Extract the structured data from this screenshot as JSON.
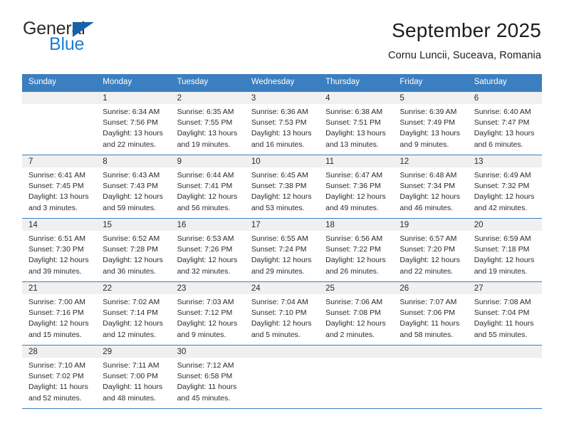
{
  "logo": {
    "primary_text": "General",
    "secondary_text": "Blue",
    "primary_color": "#2b2b2b",
    "secondary_color": "#1b7fd4",
    "triangle_color": "#1763a8"
  },
  "header": {
    "title": "September 2025",
    "subtitle": "Cornu Luncii, Suceava, Romania"
  },
  "theme": {
    "header_bar_color": "#3c7fc0",
    "day_band_color": "#f0f0f0",
    "text_color": "#2a2a2a"
  },
  "weekdays": [
    "Sunday",
    "Monday",
    "Tuesday",
    "Wednesday",
    "Thursday",
    "Friday",
    "Saturday"
  ],
  "weeks": [
    [
      {
        "day": "",
        "sunrise": "",
        "sunset": "",
        "daylight_a": "",
        "daylight_b": "",
        "empty": true
      },
      {
        "day": "1",
        "sunrise": "Sunrise: 6:34 AM",
        "sunset": "Sunset: 7:56 PM",
        "daylight_a": "Daylight: 13 hours",
        "daylight_b": "and 22 minutes."
      },
      {
        "day": "2",
        "sunrise": "Sunrise: 6:35 AM",
        "sunset": "Sunset: 7:55 PM",
        "daylight_a": "Daylight: 13 hours",
        "daylight_b": "and 19 minutes."
      },
      {
        "day": "3",
        "sunrise": "Sunrise: 6:36 AM",
        "sunset": "Sunset: 7:53 PM",
        "daylight_a": "Daylight: 13 hours",
        "daylight_b": "and 16 minutes."
      },
      {
        "day": "4",
        "sunrise": "Sunrise: 6:38 AM",
        "sunset": "Sunset: 7:51 PM",
        "daylight_a": "Daylight: 13 hours",
        "daylight_b": "and 13 minutes."
      },
      {
        "day": "5",
        "sunrise": "Sunrise: 6:39 AM",
        "sunset": "Sunset: 7:49 PM",
        "daylight_a": "Daylight: 13 hours",
        "daylight_b": "and 9 minutes."
      },
      {
        "day": "6",
        "sunrise": "Sunrise: 6:40 AM",
        "sunset": "Sunset: 7:47 PM",
        "daylight_a": "Daylight: 13 hours",
        "daylight_b": "and 6 minutes."
      }
    ],
    [
      {
        "day": "7",
        "sunrise": "Sunrise: 6:41 AM",
        "sunset": "Sunset: 7:45 PM",
        "daylight_a": "Daylight: 13 hours",
        "daylight_b": "and 3 minutes."
      },
      {
        "day": "8",
        "sunrise": "Sunrise: 6:43 AM",
        "sunset": "Sunset: 7:43 PM",
        "daylight_a": "Daylight: 12 hours",
        "daylight_b": "and 59 minutes."
      },
      {
        "day": "9",
        "sunrise": "Sunrise: 6:44 AM",
        "sunset": "Sunset: 7:41 PM",
        "daylight_a": "Daylight: 12 hours",
        "daylight_b": "and 56 minutes."
      },
      {
        "day": "10",
        "sunrise": "Sunrise: 6:45 AM",
        "sunset": "Sunset: 7:38 PM",
        "daylight_a": "Daylight: 12 hours",
        "daylight_b": "and 53 minutes."
      },
      {
        "day": "11",
        "sunrise": "Sunrise: 6:47 AM",
        "sunset": "Sunset: 7:36 PM",
        "daylight_a": "Daylight: 12 hours",
        "daylight_b": "and 49 minutes."
      },
      {
        "day": "12",
        "sunrise": "Sunrise: 6:48 AM",
        "sunset": "Sunset: 7:34 PM",
        "daylight_a": "Daylight: 12 hours",
        "daylight_b": "and 46 minutes."
      },
      {
        "day": "13",
        "sunrise": "Sunrise: 6:49 AM",
        "sunset": "Sunset: 7:32 PM",
        "daylight_a": "Daylight: 12 hours",
        "daylight_b": "and 42 minutes."
      }
    ],
    [
      {
        "day": "14",
        "sunrise": "Sunrise: 6:51 AM",
        "sunset": "Sunset: 7:30 PM",
        "daylight_a": "Daylight: 12 hours",
        "daylight_b": "and 39 minutes."
      },
      {
        "day": "15",
        "sunrise": "Sunrise: 6:52 AM",
        "sunset": "Sunset: 7:28 PM",
        "daylight_a": "Daylight: 12 hours",
        "daylight_b": "and 36 minutes."
      },
      {
        "day": "16",
        "sunrise": "Sunrise: 6:53 AM",
        "sunset": "Sunset: 7:26 PM",
        "daylight_a": "Daylight: 12 hours",
        "daylight_b": "and 32 minutes."
      },
      {
        "day": "17",
        "sunrise": "Sunrise: 6:55 AM",
        "sunset": "Sunset: 7:24 PM",
        "daylight_a": "Daylight: 12 hours",
        "daylight_b": "and 29 minutes."
      },
      {
        "day": "18",
        "sunrise": "Sunrise: 6:56 AM",
        "sunset": "Sunset: 7:22 PM",
        "daylight_a": "Daylight: 12 hours",
        "daylight_b": "and 26 minutes."
      },
      {
        "day": "19",
        "sunrise": "Sunrise: 6:57 AM",
        "sunset": "Sunset: 7:20 PM",
        "daylight_a": "Daylight: 12 hours",
        "daylight_b": "and 22 minutes."
      },
      {
        "day": "20",
        "sunrise": "Sunrise: 6:59 AM",
        "sunset": "Sunset: 7:18 PM",
        "daylight_a": "Daylight: 12 hours",
        "daylight_b": "and 19 minutes."
      }
    ],
    [
      {
        "day": "21",
        "sunrise": "Sunrise: 7:00 AM",
        "sunset": "Sunset: 7:16 PM",
        "daylight_a": "Daylight: 12 hours",
        "daylight_b": "and 15 minutes."
      },
      {
        "day": "22",
        "sunrise": "Sunrise: 7:02 AM",
        "sunset": "Sunset: 7:14 PM",
        "daylight_a": "Daylight: 12 hours",
        "daylight_b": "and 12 minutes."
      },
      {
        "day": "23",
        "sunrise": "Sunrise: 7:03 AM",
        "sunset": "Sunset: 7:12 PM",
        "daylight_a": "Daylight: 12 hours",
        "daylight_b": "and 9 minutes."
      },
      {
        "day": "24",
        "sunrise": "Sunrise: 7:04 AM",
        "sunset": "Sunset: 7:10 PM",
        "daylight_a": "Daylight: 12 hours",
        "daylight_b": "and 5 minutes."
      },
      {
        "day": "25",
        "sunrise": "Sunrise: 7:06 AM",
        "sunset": "Sunset: 7:08 PM",
        "daylight_a": "Daylight: 12 hours",
        "daylight_b": "and 2 minutes."
      },
      {
        "day": "26",
        "sunrise": "Sunrise: 7:07 AM",
        "sunset": "Sunset: 7:06 PM",
        "daylight_a": "Daylight: 11 hours",
        "daylight_b": "and 58 minutes."
      },
      {
        "day": "27",
        "sunrise": "Sunrise: 7:08 AM",
        "sunset": "Sunset: 7:04 PM",
        "daylight_a": "Daylight: 11 hours",
        "daylight_b": "and 55 minutes."
      }
    ],
    [
      {
        "day": "28",
        "sunrise": "Sunrise: 7:10 AM",
        "sunset": "Sunset: 7:02 PM",
        "daylight_a": "Daylight: 11 hours",
        "daylight_b": "and 52 minutes."
      },
      {
        "day": "29",
        "sunrise": "Sunrise: 7:11 AM",
        "sunset": "Sunset: 7:00 PM",
        "daylight_a": "Daylight: 11 hours",
        "daylight_b": "and 48 minutes."
      },
      {
        "day": "30",
        "sunrise": "Sunrise: 7:12 AM",
        "sunset": "Sunset: 6:58 PM",
        "daylight_a": "Daylight: 11 hours",
        "daylight_b": "and 45 minutes."
      },
      {
        "day": "",
        "sunrise": "",
        "sunset": "",
        "daylight_a": "",
        "daylight_b": "",
        "empty": true
      },
      {
        "day": "",
        "sunrise": "",
        "sunset": "",
        "daylight_a": "",
        "daylight_b": "",
        "empty": true
      },
      {
        "day": "",
        "sunrise": "",
        "sunset": "",
        "daylight_a": "",
        "daylight_b": "",
        "empty": true
      },
      {
        "day": "",
        "sunrise": "",
        "sunset": "",
        "daylight_a": "",
        "daylight_b": "",
        "empty": true
      }
    ]
  ]
}
